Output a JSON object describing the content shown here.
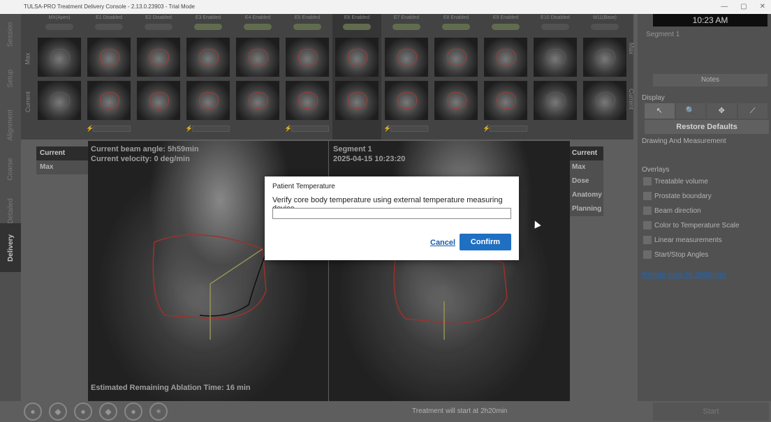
{
  "window": {
    "title": "TULSA-PRO Treatment Delivery Console - 2.13.0.23903 - Trial Mode",
    "ctrl_min": "—",
    "ctrl_max": "▢",
    "ctrl_close": "✕"
  },
  "left_tabs": [
    "Session",
    "Setup",
    "Alignment",
    "Coarse",
    "Detailed",
    "Delivery"
  ],
  "strip": {
    "row_labels": [
      "Max",
      "Current"
    ],
    "columns": [
      {
        "label": "MX(Apex)",
        "toggle": "off",
        "red": false
      },
      {
        "label": "E1 Disabled",
        "toggle": "off",
        "red": true
      },
      {
        "label": "E2 Disabled",
        "toggle": "off",
        "red": true
      },
      {
        "label": "E3 Enabled",
        "toggle": "on",
        "red": true
      },
      {
        "label": "E4 Enabled",
        "toggle": "on",
        "red": true
      },
      {
        "label": "E5 Enabled",
        "toggle": "on",
        "red": true
      },
      {
        "label": "E6 Enabled",
        "toggle": "on",
        "red": true
      },
      {
        "label": "E7 Enabled",
        "toggle": "on",
        "red": true
      },
      {
        "label": "E8 Enabled",
        "toggle": "on",
        "red": true
      },
      {
        "label": "E9 Enabled",
        "toggle": "on",
        "red": true
      },
      {
        "label": "E10 Disabled",
        "toggle": "off",
        "red": false
      },
      {
        "label": "M11(Base)",
        "toggle": "off",
        "red": false
      }
    ],
    "right_labels": [
      "Max",
      "Current"
    ]
  },
  "view_left_tabs": [
    "Current",
    "Max"
  ],
  "view_right_tabs": [
    "Current",
    "Max",
    "Dose",
    "Anatomy",
    "Planning"
  ],
  "overlay": {
    "beam_angle": "Current beam angle: 5h59min",
    "velocity": "Current velocity: 0 deg/min",
    "segment": "Segment 1",
    "timestamp": "2025-04-15 10:23:20",
    "remaining": "Estimated Remaining Ablation Time: 16 min"
  },
  "right_panel": {
    "clock": "10:23 AM",
    "segment": "Segment 1",
    "notes": "Notes",
    "display": "Display",
    "tools": [
      "↖",
      "🔍",
      "✥",
      "⟋"
    ],
    "restore": "Restore Defaults",
    "drawing": "Drawing And Measurement",
    "overlays": "Overlays",
    "overlay_items": [
      "Treatable volume",
      "Prostate boundary",
      "Beam direction",
      "Color to Temperature Scale",
      "Linear measurements",
      "Start/Stop Angles"
    ],
    "rotate": "Rotate now to 2h20min"
  },
  "bottom": {
    "status": "Treatment will start at 2h20min",
    "start": "Start"
  },
  "dialog": {
    "title": "Patient Temperature",
    "message": "Verify core body temperature using external temperature measuring device.",
    "input_value": "",
    "cancel": "Cancel",
    "confirm": "Confirm"
  }
}
